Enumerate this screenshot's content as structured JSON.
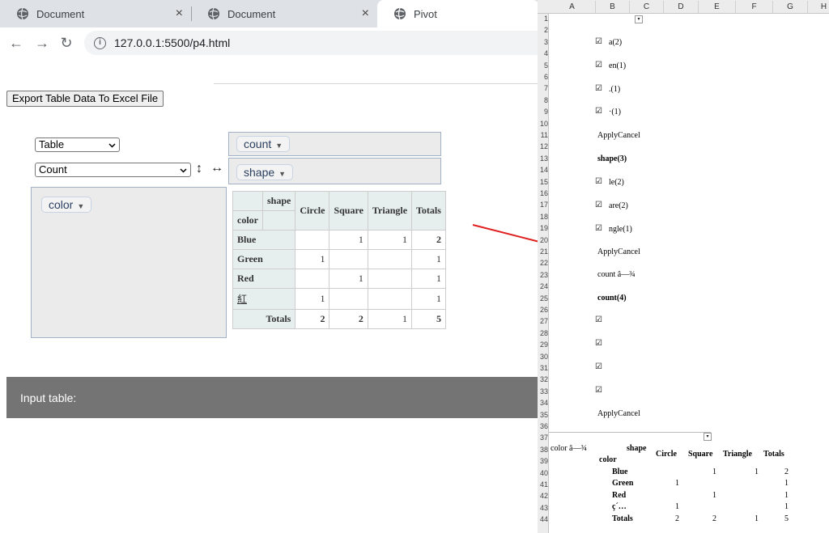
{
  "browser": {
    "tabs": [
      {
        "label": "Document",
        "close": "×"
      },
      {
        "label": "Document",
        "close": "×"
      },
      {
        "label": "Pivot"
      }
    ],
    "url": "127.0.0.1:5500/p4.html",
    "nav": {
      "back": "←",
      "forward": "→",
      "reload": "↻"
    }
  },
  "page": {
    "export_button": "Export Table Data To Excel File",
    "renderer": "Table",
    "aggregator": "Count",
    "sort_rows_icon": "↕",
    "sort_cols_icon": "↔",
    "attr_caret": "▼",
    "unused_attr": "count",
    "col_attr": "shape",
    "row_attr": "color",
    "input_title": "Input table:"
  },
  "pivot": {
    "col_axis_label": "shape",
    "row_axis_label": "color",
    "columns": [
      "Circle",
      "Square",
      "Triangle",
      "Totals"
    ],
    "rows": [
      {
        "label": "Blue",
        "values": [
          "",
          "1",
          "1",
          "2"
        ]
      },
      {
        "label": "Green",
        "values": [
          "1",
          "",
          "",
          "1"
        ]
      },
      {
        "label": "Red",
        "values": [
          "",
          "1",
          "",
          "1"
        ]
      },
      {
        "label": "紅",
        "values": [
          "1",
          "",
          "",
          "1"
        ]
      }
    ],
    "totals_label": "Totals",
    "totals": [
      "2",
      "2",
      "1",
      "5"
    ]
  },
  "excel": {
    "columns": [
      "A",
      "B",
      "C",
      "D",
      "E",
      "F",
      "G",
      "H"
    ],
    "rows": [
      "1",
      "2",
      "3",
      "4",
      "5",
      "6",
      "7",
      "8",
      "9",
      "10",
      "11",
      "12",
      "13",
      "14",
      "15",
      "16",
      "17",
      "18",
      "19",
      "20",
      "21",
      "22",
      "23",
      "24",
      "25",
      "26",
      "27",
      "28",
      "29",
      "30",
      "31",
      "32",
      "33",
      "34",
      "35",
      "36",
      "37",
      "38",
      "39",
      "40",
      "41",
      "42",
      "43",
      "44"
    ],
    "check": "☑",
    "dropdown": "▾",
    "cells": {
      "r3": "a(2)",
      "r5": "en(1)",
      "r7": ".(1)",
      "r9": "·(1)",
      "r11": "ApplyCancel",
      "r13": "shape(3)",
      "r15": "le(2)",
      "r17": "are(2)",
      "r19": "ngle(1)",
      "r21": "ApplyCancel",
      "r23": "count â—¾",
      "r25": "count(4)",
      "r35": "ApplyCancel",
      "r38a": "color â—¾",
      "r38_shape": "shape",
      "r38_cols": [
        "Circle",
        "Square",
        "Triangle",
        "Totals"
      ],
      "r39": "color",
      "pivot_rows": [
        {
          "label": "Blue",
          "values": [
            "",
            "1",
            "1",
            "2"
          ]
        },
        {
          "label": "Green",
          "values": [
            "1",
            "",
            "",
            "1"
          ]
        },
        {
          "label": "Red",
          "values": [
            "",
            "1",
            "",
            "1"
          ]
        },
        {
          "label": "ç´…",
          "values": [
            "1",
            "",
            "",
            "1"
          ]
        },
        {
          "label": "Totals",
          "values": [
            "2",
            "2",
            "1",
            "5"
          ]
        }
      ]
    }
  }
}
